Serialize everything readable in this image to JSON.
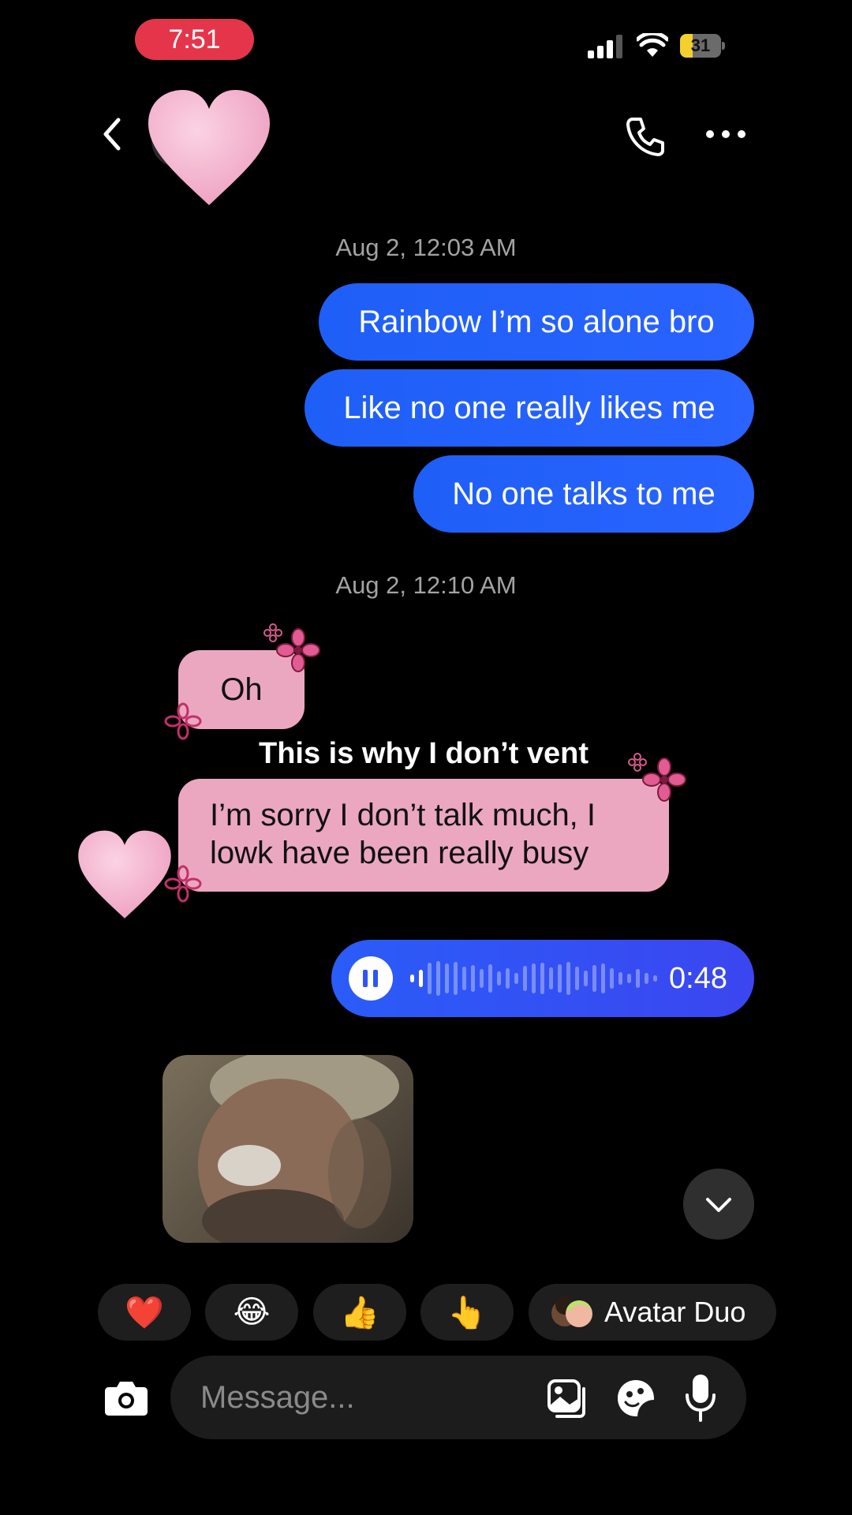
{
  "status_bar": {
    "time": "7:51",
    "battery_level": "31",
    "battery_fraction": 0.31
  },
  "header": {
    "avatar": "pink-heart-sticker",
    "icons": [
      "back-icon",
      "phone-icon",
      "more-icon"
    ]
  },
  "messages": [
    {
      "type": "timestamp",
      "text": "Aug 2, 12:03 AM"
    },
    {
      "type": "sent",
      "text": "Rainbow I’m so alone bro"
    },
    {
      "type": "sent",
      "text": "Like no one really likes me"
    },
    {
      "type": "sent",
      "text": "No one talks to me"
    },
    {
      "type": "timestamp",
      "text": "Aug 2, 12:10 AM"
    },
    {
      "type": "received",
      "text": "Oh"
    },
    {
      "type": "overlay_caption",
      "text": "This is why I don’t vent"
    },
    {
      "type": "received",
      "line1": "I’m sorry I don’t talk much, I",
      "line2": "lowk have been really busy"
    },
    {
      "type": "voice_sent",
      "duration": "0:48"
    },
    {
      "type": "video_received",
      "thumbnail": "laughing-man-video"
    }
  ],
  "quick_reactions": {
    "heart": "❤️",
    "laugh": "😂",
    "thumbs_up": "👍",
    "point": "👆",
    "avatar_duo_label": "Avatar Duo"
  },
  "composer": {
    "placeholder": "Message..."
  },
  "colors": {
    "sent_bubble": "#2a63ff",
    "received_bubble": "#eca7c0",
    "voice_bubble": "#3b46f0",
    "time_pill": "#e5354a"
  }
}
